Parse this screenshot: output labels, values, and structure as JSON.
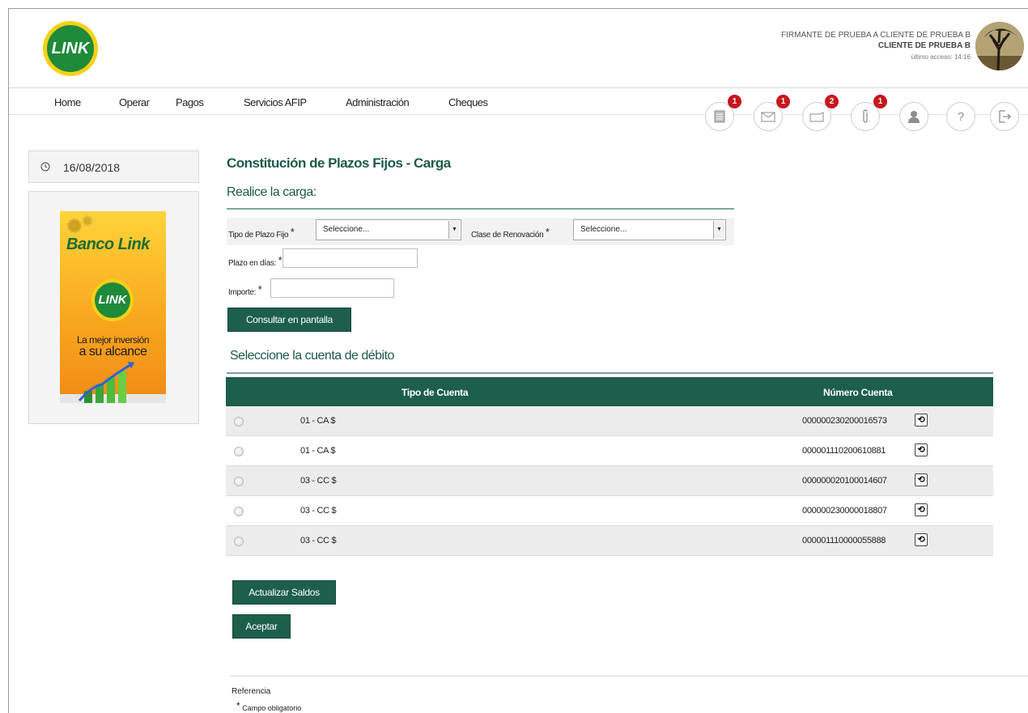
{
  "header": {
    "logo_text": "LINK",
    "user_firmante": "FIRMANTE DE PRUEBA A CLIENTE DE PRUEBA B",
    "user_cliente": "CLIENTE DE PRUEBA B",
    "last_access": "último acceso: 14:16"
  },
  "nav": {
    "items": [
      "Home",
      "Operar",
      "Pagos",
      "Servicios AFIP",
      "Administración",
      "Cheques"
    ]
  },
  "toolbar_icons": [
    {
      "name": "documents-icon",
      "badge": "1"
    },
    {
      "name": "mail-icon",
      "badge": "1"
    },
    {
      "name": "folder-icon",
      "badge": "2"
    },
    {
      "name": "attachment-icon",
      "badge": "1"
    },
    {
      "name": "user-icon",
      "badge": null
    },
    {
      "name": "help-icon",
      "badge": null,
      "glyph": "?"
    },
    {
      "name": "logout-icon",
      "badge": null
    }
  ],
  "sidebar": {
    "date": "16/08/2018",
    "promo": {
      "title": "Banco Link",
      "logo_text": "LINK",
      "line1": "La mejor inversión",
      "line2": "a su alcance"
    }
  },
  "main": {
    "title": "Constitución de Plazos Fijos - Carga",
    "section_carga": "Realice la carga:",
    "tipo_plazo_label": "Tipo de Plazo Fijo",
    "tipo_plazo_value": "Seleccione...",
    "clase_renovacion_label": "Clase de Renovación",
    "clase_renovacion_value": "Seleccione...",
    "plazo_label": "Plazo en días:",
    "plazo_value": "",
    "importe_label": "Importe:",
    "importe_value": "",
    "required_mark": "*",
    "consultar_button": "Consultar en pantalla",
    "section_cuenta": "Seleccione la cuenta de débito",
    "actualizar_button": "Actualizar Saldos",
    "aceptar_button": "Aceptar"
  },
  "accounts_table": {
    "headers": [
      "Tipo de Cuenta",
      "Número Cuenta"
    ],
    "rows": [
      {
        "tipo": "01 - CA $",
        "numero": "000000230200016573"
      },
      {
        "tipo": "01 - CA $",
        "numero": "000001110200610881"
      },
      {
        "tipo": "03 - CC $",
        "numero": "000000020100014607"
      },
      {
        "tipo": "03 - CC $",
        "numero": "000000230000018807"
      },
      {
        "tipo": "03 - CC $",
        "numero": "000001110000055888"
      }
    ]
  },
  "footer": {
    "reference_title": "Referencia",
    "required_mark": "*",
    "reference_item": "Campo obligatorio"
  },
  "colors": {
    "primary": "#1d5e4c",
    "badge": "#c8161d",
    "title": "#1d5a4a"
  }
}
